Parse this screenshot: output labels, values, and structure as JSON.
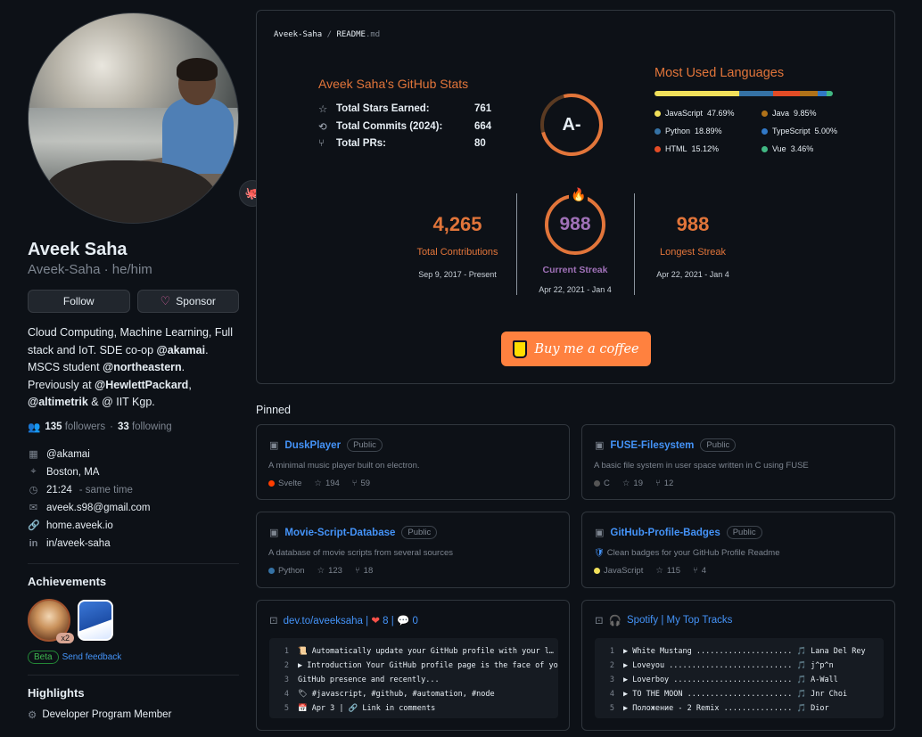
{
  "profile": {
    "name": "Aveek Saha",
    "login_line": "Aveek-Saha · he/him",
    "follow_label": "Follow",
    "sponsor_label": "Sponsor",
    "bio_parts": [
      "Cloud Computing, Machine Learning, Full stack and IoT. SDE co-op ",
      "@akamai",
      ". MSCS student ",
      "@northeastern",
      ". Previously at ",
      "@HewlettPackard",
      ", ",
      "@altimetrik",
      " & @ IIT Kgp."
    ],
    "followers_count": "135",
    "followers_label": "followers",
    "following_count": "33",
    "following_label": "following",
    "company": "@akamai",
    "location": "Boston, MA",
    "time": "21:24",
    "time_note": "- same time",
    "email": "aveek.s98@gmail.com",
    "website": "home.aveek.io",
    "linkedin": "in/aveek-saha"
  },
  "achievements": {
    "title": "Achievements",
    "badge_multiplier": "x2",
    "beta_label": "Beta",
    "feedback_label": "Send feedback"
  },
  "highlights": {
    "title": "Highlights",
    "item": "Developer Program Member"
  },
  "readme": {
    "path_owner": "Aveek-Saha",
    "path_sep": "/",
    "path_file": "README",
    "path_ext": ".md",
    "stats": {
      "title": "Aveek Saha's GitHub Stats",
      "rows": [
        {
          "label": "Total Stars Earned:",
          "value": "761"
        },
        {
          "label": "Total Commits (2024):",
          "value": "664"
        },
        {
          "label": "Total PRs:",
          "value": "80"
        }
      ],
      "grade": "A-"
    },
    "languages": {
      "title": "Most Used Languages",
      "items": [
        {
          "name": "JavaScript",
          "pct": "47.69%",
          "value": 47.69,
          "color": "#f1e05a"
        },
        {
          "name": "Python",
          "pct": "18.89%",
          "value": 18.89,
          "color": "#3572A5"
        },
        {
          "name": "HTML",
          "pct": "15.12%",
          "value": 15.12,
          "color": "#e34c26"
        },
        {
          "name": "Java",
          "pct": "9.85%",
          "value": 9.85,
          "color": "#b07219"
        },
        {
          "name": "TypeScript",
          "pct": "5.00%",
          "value": 5.0,
          "color": "#3178c6"
        },
        {
          "name": "Vue",
          "pct": "3.46%",
          "value": 3.46,
          "color": "#41b883"
        }
      ]
    },
    "streak": {
      "total": "4,265",
      "total_label": "Total Contributions",
      "total_range": "Sep 9, 2017 - Present",
      "current": "988",
      "current_label": "Current Streak",
      "current_range": "Apr 22, 2021 - Jan 4",
      "longest": "988",
      "longest_label": "Longest Streak",
      "longest_range": "Apr 22, 2021 - Jan 4"
    },
    "coffee_label": "Buy me a coffee"
  },
  "pinned": {
    "title": "Pinned",
    "public_label": "Public",
    "repos": [
      {
        "name": "DuskPlayer",
        "desc": "A minimal music player built on electron.",
        "lang": "Svelte",
        "lang_color": "#ff3e00",
        "stars": "194",
        "forks": "59"
      },
      {
        "name": "FUSE-Filesystem",
        "desc": "A basic file system in user space written in C using FUSE",
        "lang": "C",
        "lang_color": "#555555",
        "stars": "19",
        "forks": "12"
      },
      {
        "name": "Movie-Script-Database",
        "desc": "A database of movie scripts from several sources",
        "lang": "Python",
        "lang_color": "#3572A5",
        "stars": "123",
        "forks": "18"
      },
      {
        "name": "GitHub-Profile-Badges",
        "desc": "Clean badges for your GitHub Profile Readme",
        "lang": "JavaScript",
        "lang_color": "#f1e05a",
        "stars": "115",
        "forks": "4"
      }
    ],
    "gist_devto": {
      "title": "dev.to/aveeksaha | ",
      "hearts": "8",
      "sep": " | ",
      "comments": "0",
      "lines": [
        "📜 Automatically update your GitHub profile with your l…",
        "▶ Introduction Your GitHub profile page is the face of yo",
        "GitHub presence and recently...",
        "🏷 #javascript, #github, #automation, #node",
        "📅 Apr 3 | 🔗 Link in comments"
      ],
      "line_numbers": [
        "1",
        "2",
        "3",
        "4",
        "5"
      ]
    },
    "gist_spotify": {
      "title": "Spotify | My Top Tracks",
      "lines": [
        "▶ White Mustang ..................... 🎵 Lana Del Rey",
        "▶ Loveyou ........................... 🎵 j^p^n",
        "▶ Loverboy .......................... 🎵 A-Wall",
        "▶ TO THE MOON ....................... 🎵 Jnr Choi",
        "▶ Положение - 2 Remix ............... 🎵 Dior"
      ],
      "line_numbers": [
        "1",
        "2",
        "3",
        "4",
        "5"
      ]
    }
  }
}
